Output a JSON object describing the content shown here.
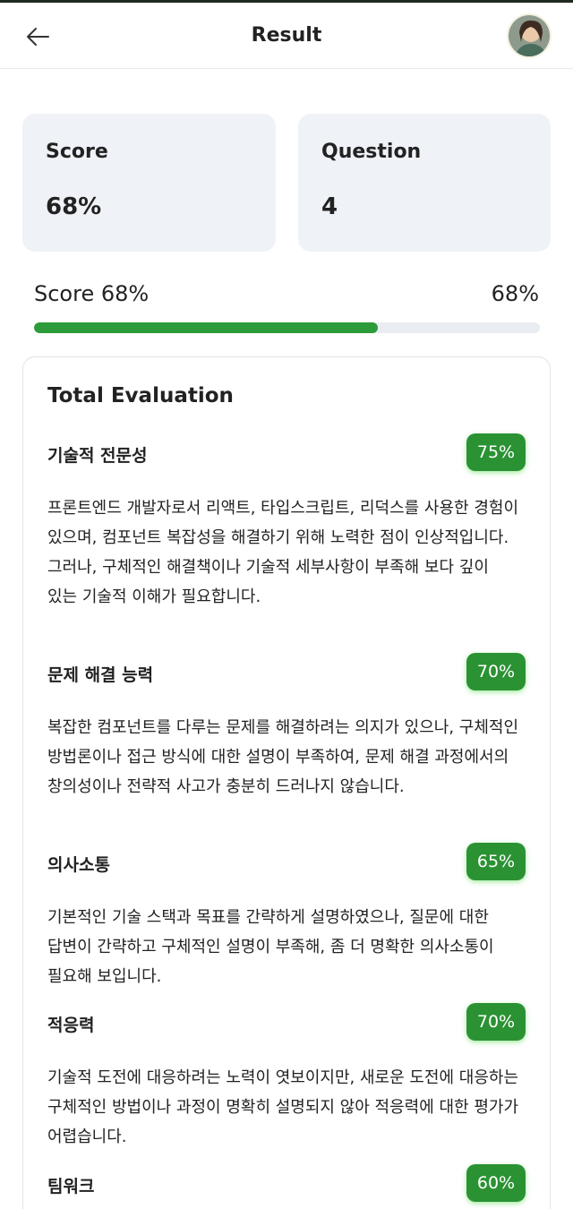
{
  "header": {
    "title": "Result",
    "back_icon": "arrow-left-icon",
    "avatar_icon": "user-avatar"
  },
  "stats": {
    "score_label": "Score",
    "score_value": "68%",
    "question_label": "Question",
    "question_value": "4"
  },
  "progress": {
    "label": "Score 68%",
    "value_text": "68%",
    "value": 0.68,
    "color": "#2e9b3a"
  },
  "evaluation": {
    "title": "Total Evaluation",
    "items": [
      {
        "name": "기술적 전문성",
        "score": "75%",
        "description": "프론트엔드 개발자로서 리액트, 타입스크립트, 리덕스를 사용한 경험이 있으며, 컴포넌트 복잡성을 해결하기 위해 노력한 점이 인상적입니다. 그러나, 구체적인 해결책이나 기술적 세부사항이 부족해 보다 깊이 있는 기술적 이해가 필요합니다."
      },
      {
        "name": "문제 해결 능력",
        "score": "70%",
        "description": "복잡한 컴포넌트를 다루는 문제를 해결하려는 의지가 있으나, 구체적인 방법론이나 접근 방식에 대한 설명이 부족하여, 문제 해결 과정에서의 창의성이나 전략적 사고가 충분히 드러나지 않습니다."
      },
      {
        "name": "의사소통",
        "score": "65%",
        "description": "기본적인 기술 스택과 목표를 간략하게 설명하였으나, 질문에 대한 답변이 간략하고 구체적인 설명이 부족해, 좀 더 명확한 의사소통이 필요해 보입니다."
      },
      {
        "name": "적응력",
        "score": "70%",
        "description": "기술적 도전에 대응하려는 노력이 엿보이지만, 새로운 도전에 대응하는 구체적인 방법이나 과정이 명확히 설명되지 않아 적응력에 대한 평가가 어렵습니다."
      },
      {
        "name": "팀워크",
        "score": "60%",
        "description": ""
      }
    ],
    "badge_color": "#2b9233"
  }
}
